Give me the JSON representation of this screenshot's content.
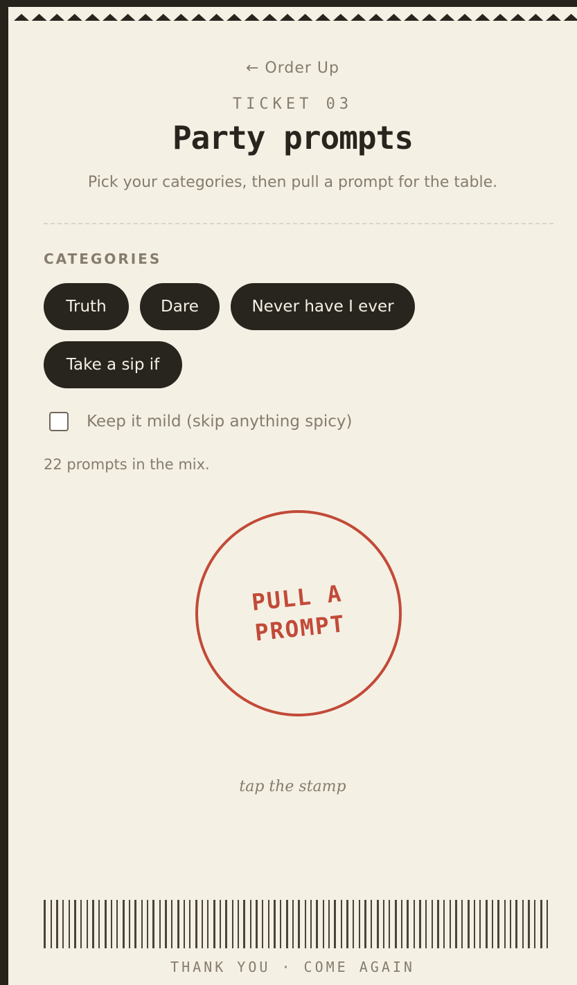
{
  "nav": {
    "back_label": "← Order Up"
  },
  "ticket": {
    "label": "TICKET 03"
  },
  "header": {
    "title": "Party prompts",
    "subtitle": "Pick your categories, then pull a prompt for the table."
  },
  "categories": {
    "label": "CATEGORIES",
    "items": [
      {
        "label": "Truth",
        "selected": true
      },
      {
        "label": "Dare",
        "selected": true
      },
      {
        "label": "Never have I ever",
        "selected": true
      },
      {
        "label": "Take a sip if",
        "selected": true
      }
    ]
  },
  "filter": {
    "mild_label": "Keep it mild (skip anything spicy)",
    "mild_checked": false
  },
  "status": {
    "count_text": "22 prompts in the mix."
  },
  "stamp": {
    "label": "PULL A PROMPT",
    "hint": "tap the stamp"
  },
  "footer": {
    "text": "THANK YOU · COME AGAIN"
  },
  "colors": {
    "paper": "#f5f0e4",
    "ink": "#28241e",
    "muted": "#857c6c",
    "stamp_red": "#c24a38",
    "frame": "#26221c"
  }
}
